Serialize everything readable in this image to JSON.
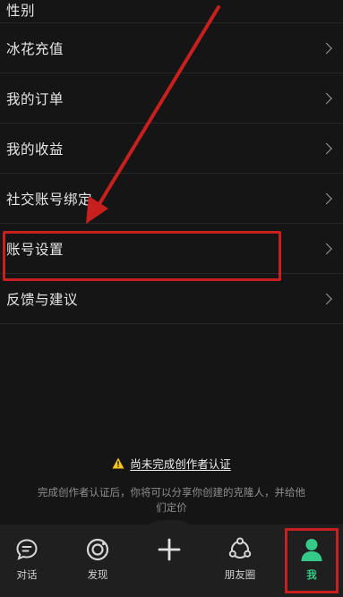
{
  "menu": {
    "items": [
      {
        "label": "性别"
      },
      {
        "label": "冰花充值"
      },
      {
        "label": "我的订单"
      },
      {
        "label": "我的收益"
      },
      {
        "label": "社交账号绑定"
      },
      {
        "label": "账号设置"
      },
      {
        "label": "反馈与建议"
      }
    ]
  },
  "notice": {
    "title": "尚未完成创作者认证",
    "body": "完成创作者认证后，你将可以分享你创建的克隆人，并给他们定价"
  },
  "tabbar": {
    "items": [
      {
        "label": "对话",
        "icon": "chat-bubble-icon"
      },
      {
        "label": "发现",
        "icon": "discover-icon"
      },
      {
        "label": "",
        "icon": "plus-icon"
      },
      {
        "label": "朋友圈",
        "icon": "friends-circle-icon"
      },
      {
        "label": "我",
        "icon": "me-person-icon"
      }
    ]
  },
  "colors": {
    "accent": "#35c98a",
    "annotation": "#c8201e",
    "background": "#151515",
    "tabbar": "#1f1f1f",
    "warning": "#f5c518"
  }
}
